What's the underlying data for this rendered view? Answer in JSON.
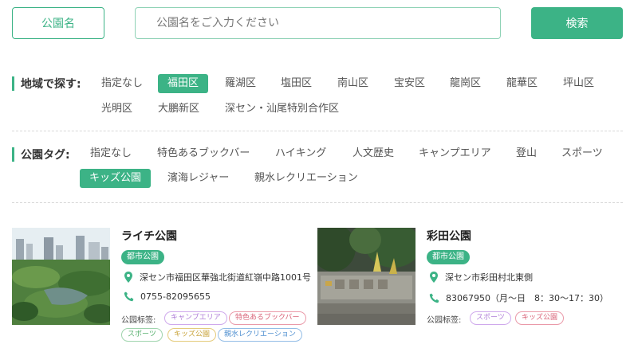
{
  "search": {
    "park_name_select": "公園名",
    "placeholder": "公園名をご入力ください",
    "button": "検索"
  },
  "region": {
    "label": "地域で探す:",
    "options": [
      "指定なし",
      "福田区",
      "羅湖区",
      "塩田区",
      "南山区",
      "宝安区",
      "龍崗区",
      "龍華区",
      "坪山区",
      "光明区",
      "大鵬新区",
      "深セン・汕尾特別合作区"
    ],
    "active": "福田区"
  },
  "park_tag": {
    "label": "公園タグ:",
    "options": [
      "指定なし",
      "特色あるブックバー",
      "ハイキング",
      "人文歴史",
      "キャンプエリア",
      "登山",
      "スポーツ",
      "キッズ公園",
      "濱海レジャー",
      "親水レクリエーション"
    ],
    "active": "キッズ公園"
  },
  "parks": [
    {
      "name": "ライチ公園",
      "type": "都市公園",
      "address": "深セン市福田区華強北街道紅嶺中路1001号",
      "phone": "0755-82095655",
      "tags_label": "公园标签:",
      "tags": [
        {
          "text": "キャンプエリア",
          "color": "purple"
        },
        {
          "text": "特色あるブックバー",
          "color": "red"
        },
        {
          "text": "スポーツ",
          "color": "green"
        },
        {
          "text": "キッズ公園",
          "color": "yellow"
        },
        {
          "text": "親水レクリエーション",
          "color": "blue"
        }
      ],
      "image": "city-park-aerial-photo"
    },
    {
      "name": "彩田公園",
      "type": "都市公園",
      "address": "深セン市彩田村北東側",
      "phone": "83067950（月～日　8：30～17：30）",
      "tags_label": "公园标签:",
      "tags": [
        {
          "text": "スポーツ",
          "color": "purple"
        },
        {
          "text": "キッズ公園",
          "color": "red"
        }
      ],
      "image": "park-entrance-sign-photo"
    }
  ],
  "colors": {
    "accent": "#3cb386",
    "tag_purple": "#b07fd8",
    "tag_red": "#d9657a",
    "tag_green": "#57b06e",
    "tag_yellow": "#c8a33a",
    "tag_blue": "#4f8fd0"
  },
  "icons": [
    "location-pin-icon",
    "phone-icon"
  ]
}
